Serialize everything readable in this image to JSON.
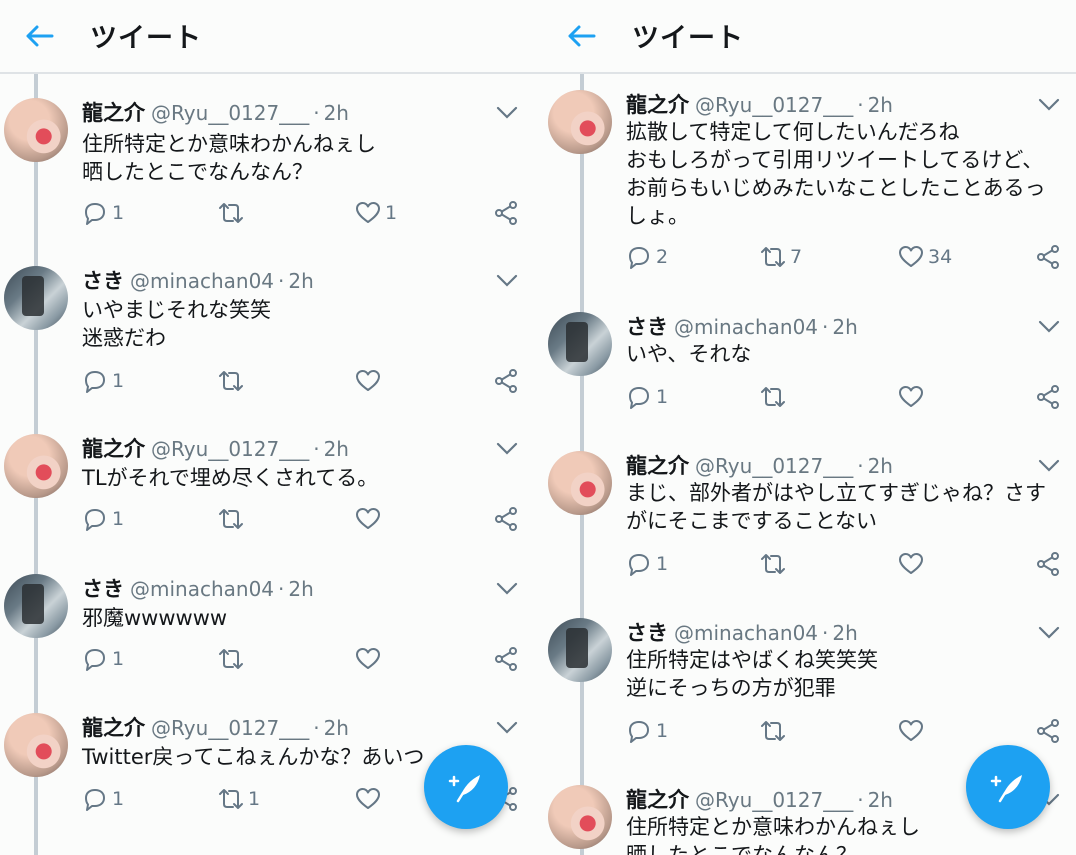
{
  "left": {
    "title": "ツイート",
    "tweets": [
      {
        "name": "龍之介",
        "handle": "@Ryu__0127___",
        "sep": "·",
        "time": "2h",
        "avatar": "ryu",
        "text": "住所特定とか意味わかんねぇし\n晒したとこでなんなん？",
        "reply": "1",
        "retweet": "",
        "like": "1"
      },
      {
        "name": "さき",
        "handle": "@minachan04",
        "sep": "·",
        "time": "2h",
        "avatar": "saki",
        "text": "いやまじそれな笑笑\n迷惑だわ",
        "reply": "1",
        "retweet": "",
        "like": ""
      },
      {
        "name": "龍之介",
        "handle": "@Ryu__0127___",
        "sep": "·",
        "time": "2h",
        "avatar": "ryu",
        "text": "TLがそれで埋め尽くされてる。",
        "reply": "1",
        "retweet": "",
        "like": ""
      },
      {
        "name": "さき",
        "handle": "@minachan04",
        "sep": "·",
        "time": "2h",
        "avatar": "saki",
        "text": "邪魔wwwwww",
        "reply": "1",
        "retweet": "",
        "like": ""
      },
      {
        "name": "龍之介",
        "handle": "@Ryu__0127___",
        "sep": "·",
        "time": "2h",
        "avatar": "ryu",
        "text": "Twitter戻ってこねぇんかな？あいつ",
        "reply": "1",
        "retweet": "1",
        "like": ""
      }
    ]
  },
  "right": {
    "title": "ツイート",
    "tweets": [
      {
        "name": "龍之介",
        "handle": "@Ryu__0127___",
        "sep": "·",
        "time": "2h",
        "avatar": "ryu",
        "text": "拡散して特定して何したいんだろね\nおもしろがって引用リツイートしてるけど、\nお前らもいじめみたいなことしたことあるっ\nしょ。",
        "reply": "2",
        "retweet": "7",
        "like": "34"
      },
      {
        "name": "さき",
        "handle": "@minachan04",
        "sep": "·",
        "time": "2h",
        "avatar": "saki",
        "text": "いや、それな",
        "reply": "1",
        "retweet": "",
        "like": ""
      },
      {
        "name": "龍之介",
        "handle": "@Ryu__0127___",
        "sep": "·",
        "time": "2h",
        "avatar": "ryu",
        "text": "まじ、部外者がはやし立てすぎじゃね？さす\nがにそこまですることない",
        "reply": "1",
        "retweet": "",
        "like": ""
      },
      {
        "name": "さき",
        "handle": "@minachan04",
        "sep": "·",
        "time": "2h",
        "avatar": "saki",
        "text": "住所特定はやばくね笑笑笑\n逆にそっちの方が犯罪",
        "reply": "1",
        "retweet": "",
        "like": ""
      },
      {
        "name": "龍之介",
        "handle": "@Ryu__0127___",
        "sep": "·",
        "time": "2h",
        "avatar": "ryu",
        "text": "住所特定とか意味わかんねぇし\n晒したとこでなんなん？",
        "reply": "",
        "retweet": "",
        "like": ""
      }
    ]
  },
  "icons": {
    "back": "arrow-left-icon",
    "caret": "chevron-down-icon",
    "reply": "reply-icon",
    "retweet": "retweet-icon",
    "like": "heart-icon",
    "share": "share-icon",
    "compose": "compose-tweet-icon"
  },
  "colors": {
    "accent": "#1da1f2",
    "text": "#14171a",
    "muted": "#657786",
    "thread": "#c4cdd4"
  }
}
